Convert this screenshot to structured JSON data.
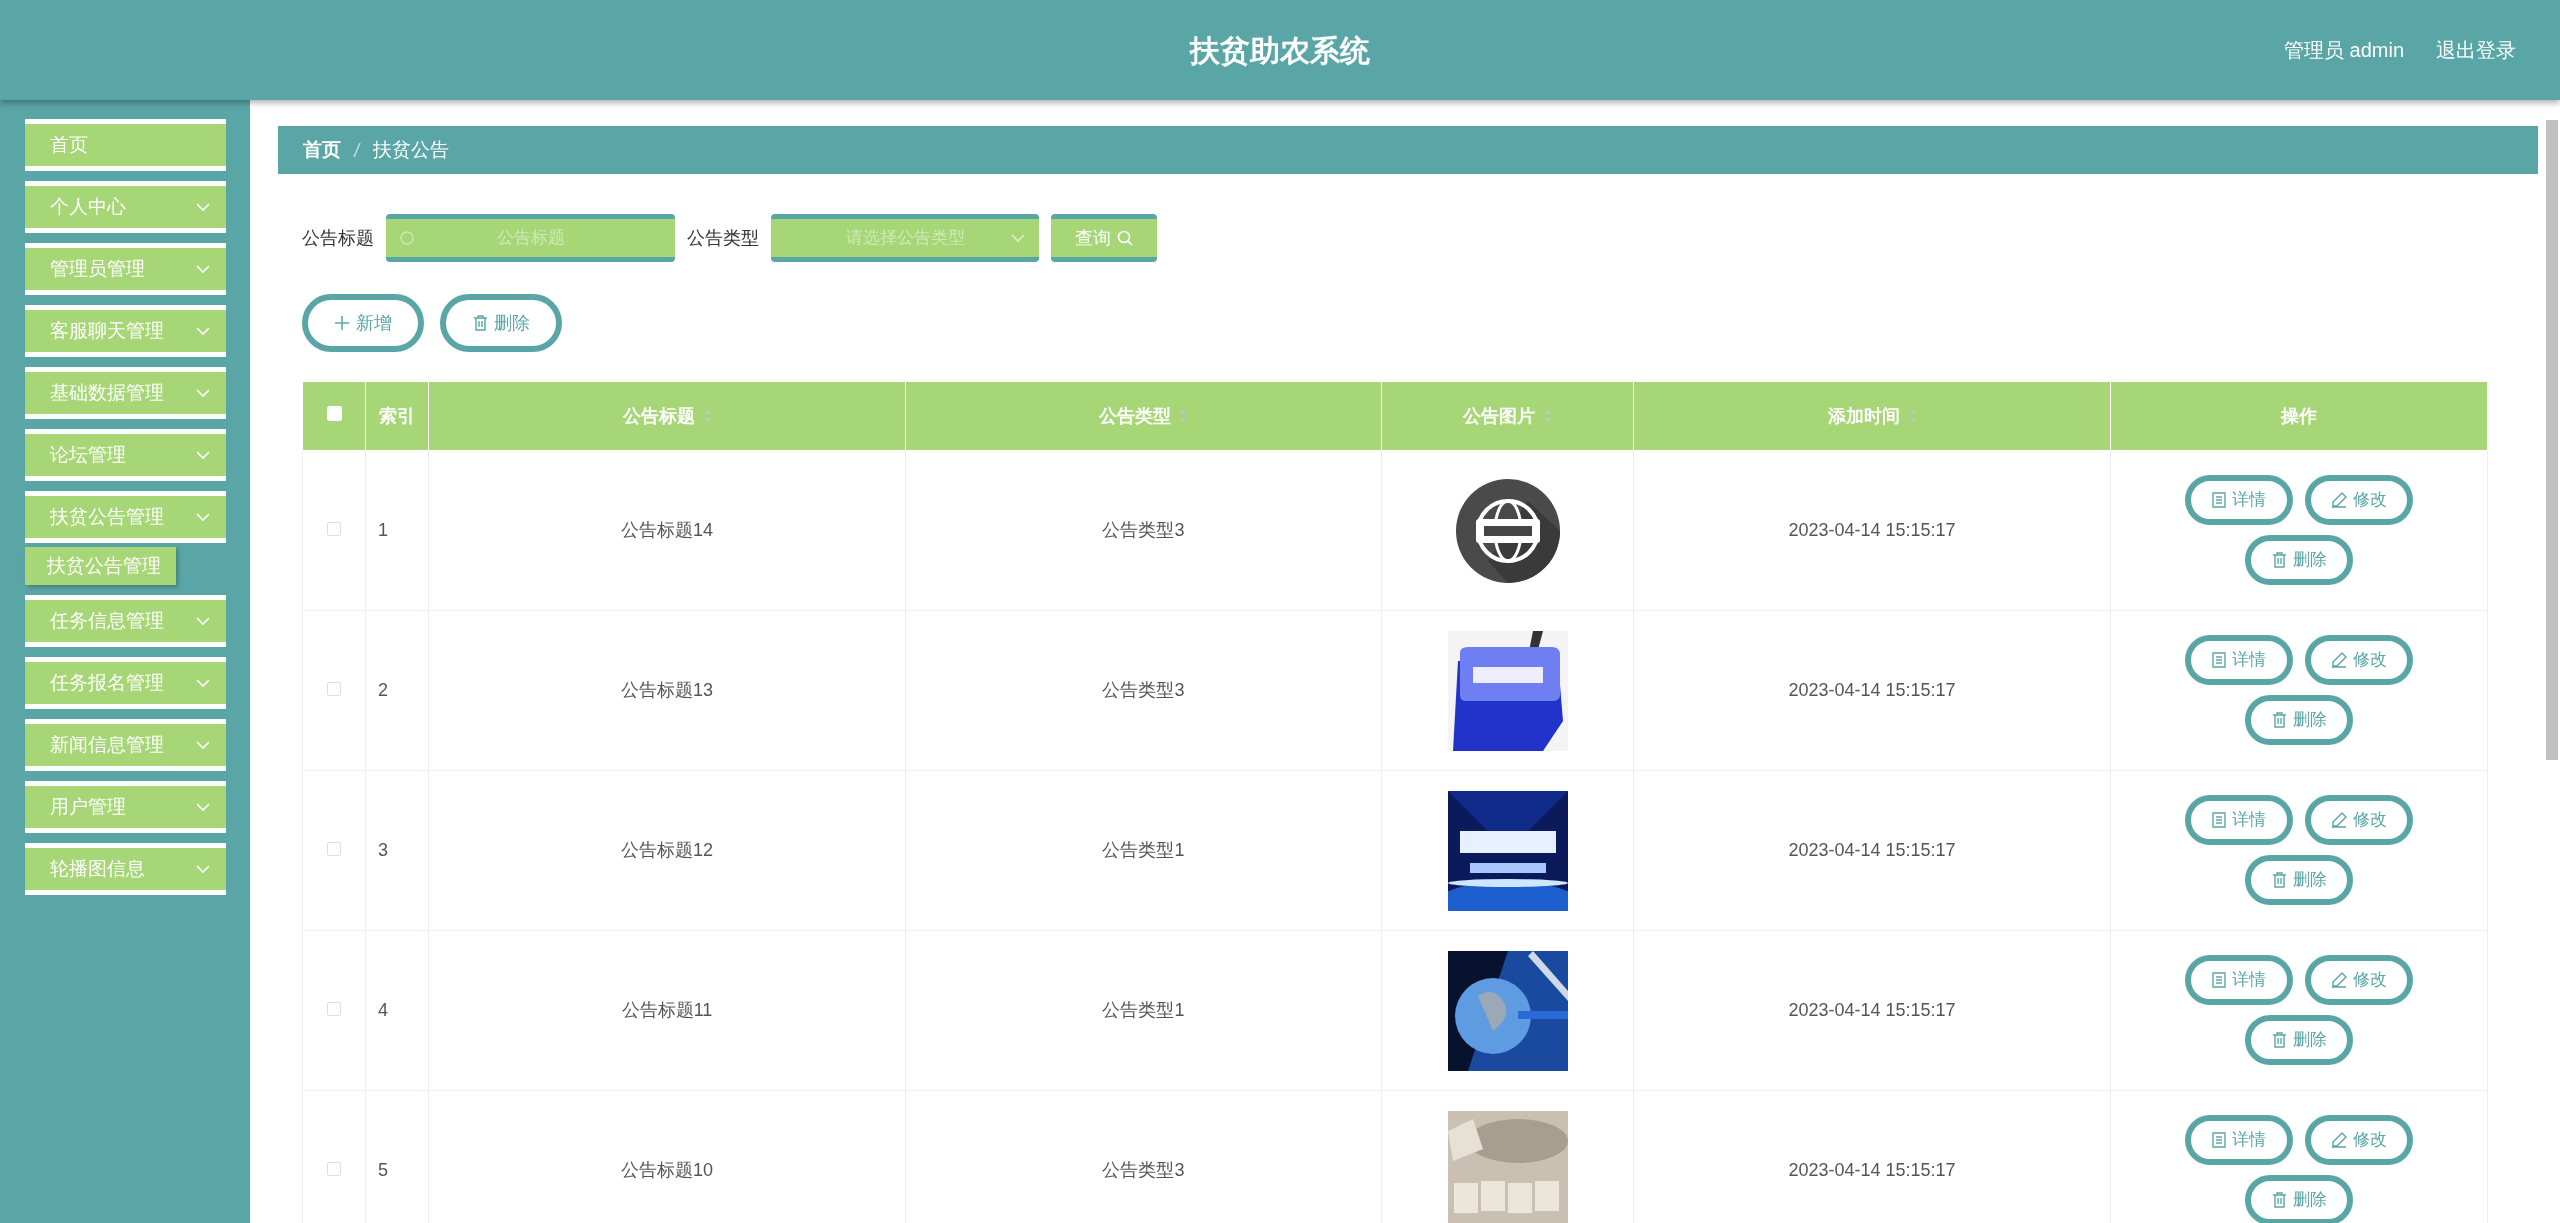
{
  "header": {
    "title": "扶贫助农系统",
    "user": "管理员 admin",
    "logout": "退出登录"
  },
  "sidebar": {
    "items": [
      {
        "label": "首页",
        "kind": "link"
      },
      {
        "label": "个人中心",
        "kind": "menu"
      },
      {
        "label": "管理员管理",
        "kind": "menu"
      },
      {
        "label": "客服聊天管理",
        "kind": "menu"
      },
      {
        "label": "基础数据管理",
        "kind": "menu"
      },
      {
        "label": "论坛管理",
        "kind": "menu"
      },
      {
        "label": "扶贫公告管理",
        "kind": "menu",
        "children": [
          {
            "label": "扶贫公告管理"
          }
        ]
      },
      {
        "label": "任务信息管理",
        "kind": "menu"
      },
      {
        "label": "任务报名管理",
        "kind": "menu"
      },
      {
        "label": "新闻信息管理",
        "kind": "menu"
      },
      {
        "label": "用户管理",
        "kind": "menu"
      },
      {
        "label": "轮播图信息",
        "kind": "menu"
      }
    ]
  },
  "breadcrumb": [
    "首页",
    "扶贫公告"
  ],
  "search": {
    "fields": [
      {
        "label": "公告标题",
        "placeholder": "公告标题",
        "kind": "text"
      },
      {
        "label": "公告类型",
        "placeholder": "请选择公告类型",
        "kind": "select"
      }
    ],
    "button": "查询"
  },
  "actions": [
    {
      "label": "新增",
      "kind": "add"
    },
    {
      "label": "删除",
      "kind": "delete"
    }
  ],
  "table": {
    "select_all": {
      "checked": false
    },
    "columns": [
      {
        "label": "索引",
        "sortable": false
      },
      {
        "label": "公告标题",
        "sortable": true
      },
      {
        "label": "公告类型",
        "sortable": true
      },
      {
        "label": "公告图片",
        "sortable": true
      },
      {
        "label": "添加时间",
        "sortable": true
      },
      {
        "label": "操作",
        "sortable": false
      }
    ],
    "rows": [
      {
        "checked": false,
        "index": "1",
        "title": "公告标题14",
        "type": "公告类型3",
        "time": "2023-04-14 15:15:17",
        "actions": [
          {
            "label": "详情",
            "kind": "detail"
          },
          {
            "label": "修改",
            "kind": "edit"
          },
          {
            "label": "删除",
            "kind": "delete"
          }
        ]
      },
      {
        "checked": false,
        "index": "2",
        "title": "公告标题13",
        "type": "公告类型3",
        "time": "2023-04-14 15:15:17",
        "actions": [
          {
            "label": "详情",
            "kind": "detail"
          },
          {
            "label": "修改",
            "kind": "edit"
          },
          {
            "label": "删除",
            "kind": "delete"
          }
        ]
      },
      {
        "checked": false,
        "index": "3",
        "title": "公告标题12",
        "type": "公告类型1",
        "time": "2023-04-14 15:15:17",
        "actions": [
          {
            "label": "详情",
            "kind": "detail"
          },
          {
            "label": "修改",
            "kind": "edit"
          },
          {
            "label": "删除",
            "kind": "delete"
          }
        ]
      },
      {
        "checked": false,
        "index": "4",
        "title": "公告标题11",
        "type": "公告类型1",
        "time": "2023-04-14 15:15:17",
        "actions": [
          {
            "label": "详情",
            "kind": "detail"
          },
          {
            "label": "修改",
            "kind": "edit"
          },
          {
            "label": "删除",
            "kind": "delete"
          }
        ]
      },
      {
        "checked": false,
        "index": "5",
        "title": "公告标题10",
        "type": "公告类型3",
        "time": "2023-04-14 15:15:17",
        "actions": [
          {
            "label": "详情",
            "kind": "detail"
          },
          {
            "label": "修改",
            "kind": "edit"
          },
          {
            "label": "删除",
            "kind": "delete"
          }
        ]
      }
    ]
  }
}
